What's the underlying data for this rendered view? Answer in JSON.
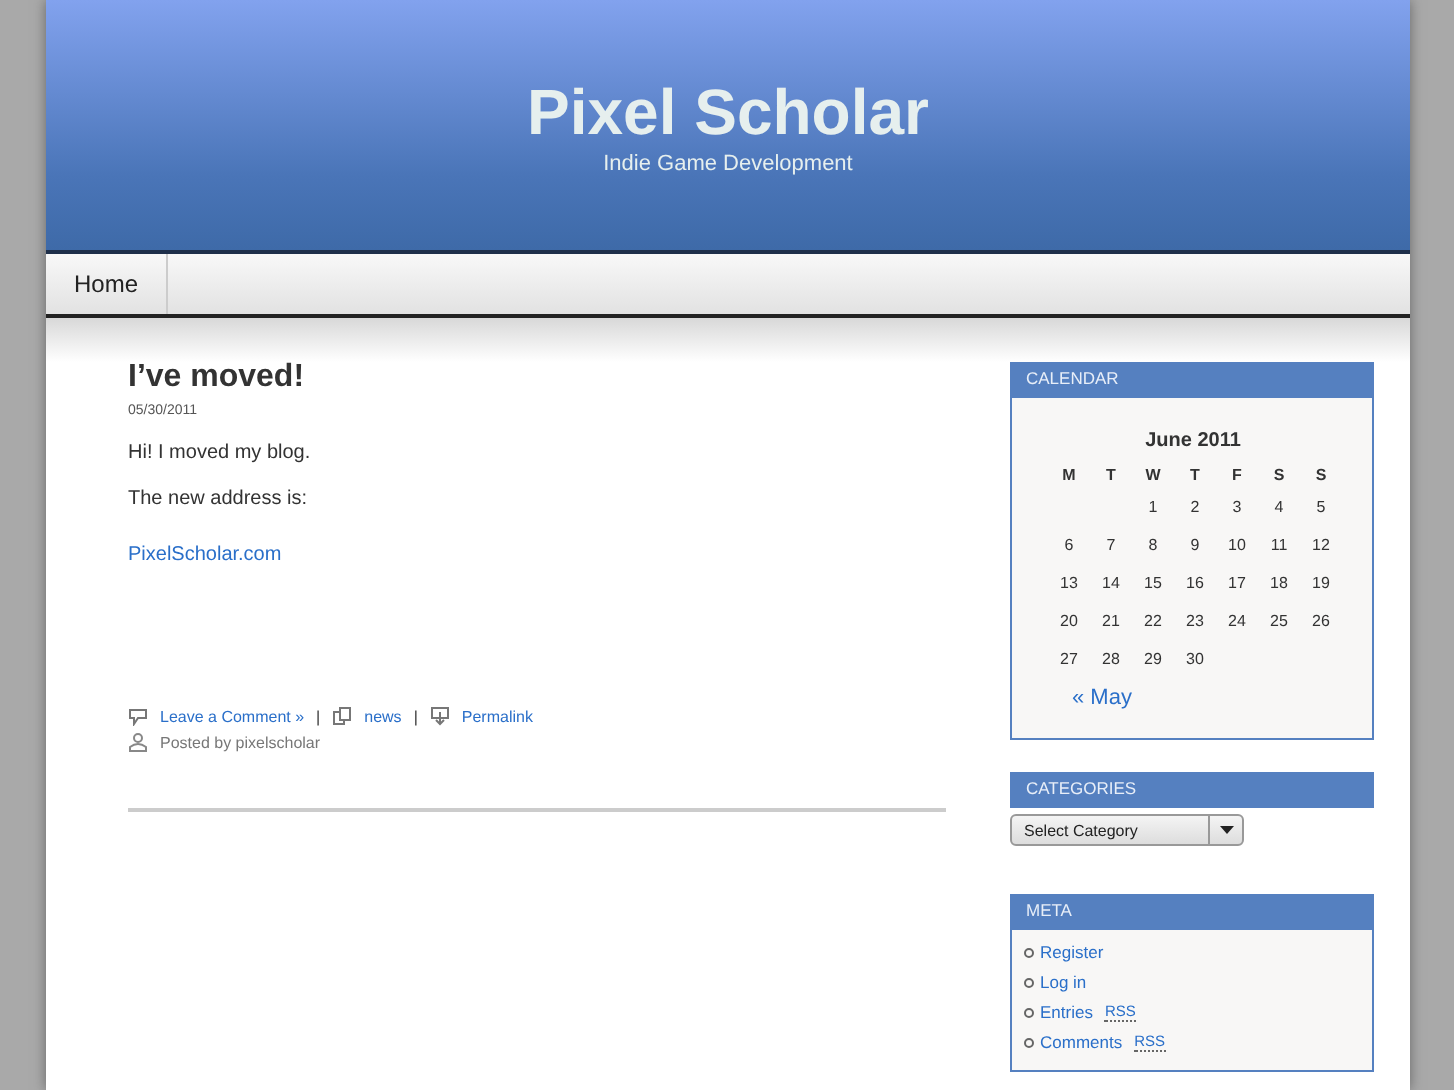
{
  "header": {
    "title": "Pixel Scholar",
    "tagline": "Indie Game Development"
  },
  "nav": [
    {
      "label": "Home",
      "selected": false
    }
  ],
  "post": {
    "title": "I’ve moved!",
    "date": "05/30/2011",
    "paragraphs": [
      "Hi!  I moved my blog.",
      "The new address is:"
    ],
    "link": "PixelScholar.com",
    "meta": {
      "comment": "Leave a Comment »",
      "category": "news",
      "permalink": "Permalink",
      "separator": "|",
      "posted_by": "Posted by pixelscholar"
    }
  },
  "calendar": {
    "heading": "CALENDAR",
    "caption": "June 2011",
    "weekdays": [
      "M",
      "T",
      "W",
      "T",
      "F",
      "S",
      "S"
    ],
    "weeks": [
      {
        "kind": "first",
        "days": [
          "1",
          "2",
          "3",
          "4",
          "5"
        ]
      },
      {
        "kind": "full",
        "days": [
          "6",
          "7",
          "8",
          "9",
          "10",
          "11",
          "12"
        ]
      },
      {
        "kind": "full",
        "days": [
          "13",
          "14",
          "15",
          "16",
          "17",
          "18",
          "19"
        ]
      },
      {
        "kind": "full",
        "days": [
          "20",
          "21",
          "22",
          "23",
          "24",
          "25",
          "26"
        ]
      },
      {
        "kind": "last",
        "days": [
          "27",
          "28",
          "29",
          "30"
        ]
      }
    ],
    "prev": "« May"
  },
  "categories": {
    "heading": "CATEGORIES",
    "select": "Select Category"
  },
  "meta": {
    "heading": "META",
    "items": [
      {
        "label": "Register"
      },
      {
        "label": "Log in"
      },
      {
        "label": "Entries",
        "abbr": "RSS"
      },
      {
        "label": "Comments",
        "abbr": "RSS"
      }
    ]
  }
}
